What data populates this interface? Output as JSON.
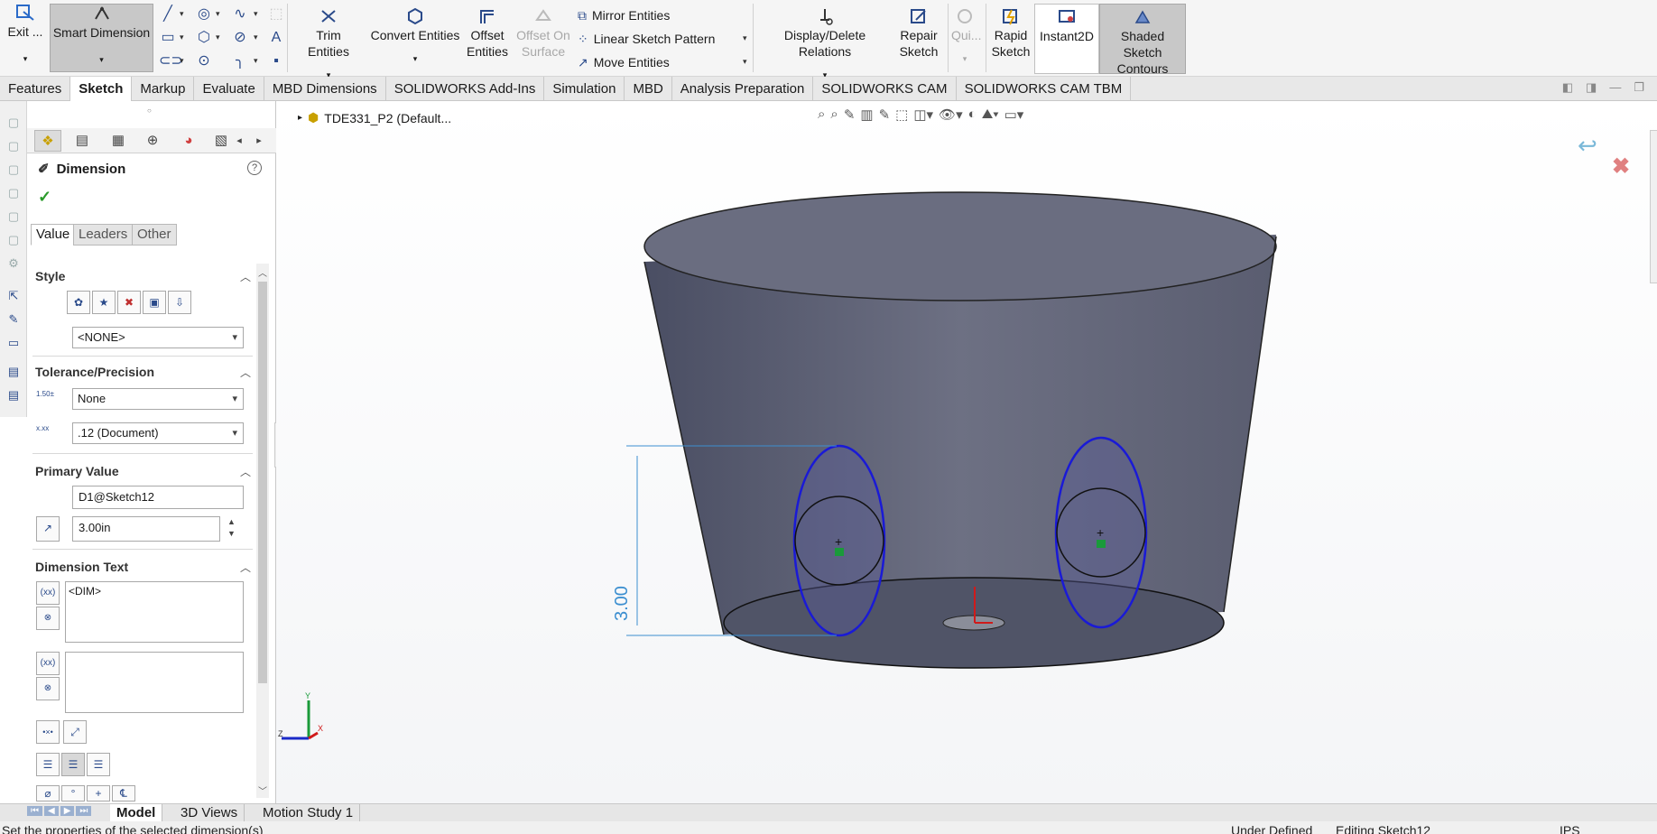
{
  "ribbon": {
    "exit_label": "Exit ...",
    "smart_dimension_label": "Smart Dimension",
    "trim_label": "Trim Entities",
    "convert_label": "Convert Entities",
    "offset_label_1": "Offset",
    "offset_label_2": "Entities",
    "offset_surface_1": "Offset On",
    "offset_surface_2": "Surface",
    "mirror_label": "Mirror Entities",
    "linear_pattern_label": "Linear Sketch Pattern",
    "move_label": "Move Entities",
    "display_relations_label": "Display/Delete Relations",
    "repair_1": "Repair",
    "repair_2": "Sketch",
    "quick_label": "Qui...",
    "rapid_1": "Rapid",
    "rapid_2": "Sketch",
    "instant2d_label": "Instant2D",
    "shaded_1": "Shaded Sketch",
    "shaded_2": "Contours"
  },
  "tabs": [
    "Features",
    "Sketch",
    "Markup",
    "Evaluate",
    "MBD Dimensions",
    "SOLIDWORKS Add-Ins",
    "Simulation",
    "MBD",
    "Analysis Preparation",
    "SOLIDWORKS CAM",
    "SOLIDWORKS CAM TBM"
  ],
  "active_tab": "Sketch",
  "pm": {
    "title": "Dimension",
    "subtabs": [
      "Value",
      "Leaders",
      "Other"
    ],
    "style_head": "Style",
    "style_value": "<NONE>",
    "tol_head": "Tolerance/Precision",
    "tol_value": "None",
    "precision_value": ".12 (Document)",
    "primary_head": "Primary Value",
    "primary_name": "D1@Sketch12",
    "primary_value": "3.00in",
    "dimtext_head": "Dimension Text",
    "dimtext_value": "<DIM>"
  },
  "breadcrumb": "TDE331_P2  (Default...",
  "dimension_label": "3.00",
  "bottom_tabs": [
    "Model",
    "3D Views",
    "Motion Study 1"
  ],
  "status": {
    "left": "Set the properties of the selected dimension(s)",
    "middle": "Under Defined",
    "editing": "Editing Sketch12",
    "units": "IPS"
  },
  "colors": {
    "accent": "#1f3fa0",
    "sketch_line": "#1a1ad6",
    "dim_line": "#3c8fd0",
    "part": "#55596c",
    "axis_y": "#1a9a3a",
    "axis_x": "#d01a1a"
  }
}
